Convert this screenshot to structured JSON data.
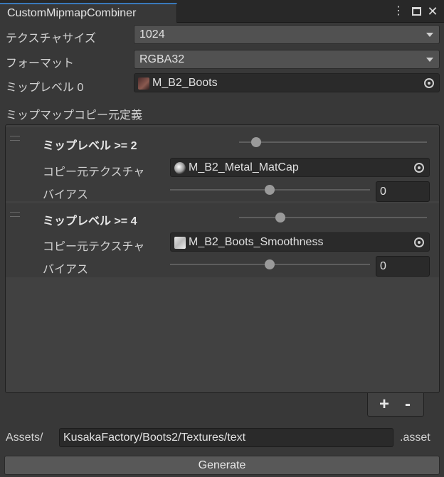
{
  "window": {
    "title": "CustomMipmapCombiner"
  },
  "fields": {
    "texture_size": {
      "label": "テクスチャサイズ",
      "value": "1024"
    },
    "format": {
      "label": "フォーマット",
      "value": "RGBA32"
    },
    "mip0": {
      "label": "ミップレベル 0",
      "value": "M_B2_Boots"
    }
  },
  "section_title": "ミップマップコピー元定義",
  "entries": [
    {
      "header": "ミップレベル >= 2",
      "source_label": "コピー元テクスチャ",
      "source_value": "M_B2_Metal_MatCap",
      "bias_label": "バイアス",
      "bias_value": "0"
    },
    {
      "header": "ミップレベル >= 4",
      "source_label": "コピー元テクスチャ",
      "source_value": "M_B2_Boots_Smoothness",
      "bias_label": "バイアス",
      "bias_value": "0"
    }
  ],
  "list_buttons": {
    "add": "+",
    "remove": "-"
  },
  "output": {
    "prefix": "Assets/",
    "path": "KusakaFactory/Boots2/Textures/text",
    "suffix": ".asset"
  },
  "generate_label": "Generate"
}
